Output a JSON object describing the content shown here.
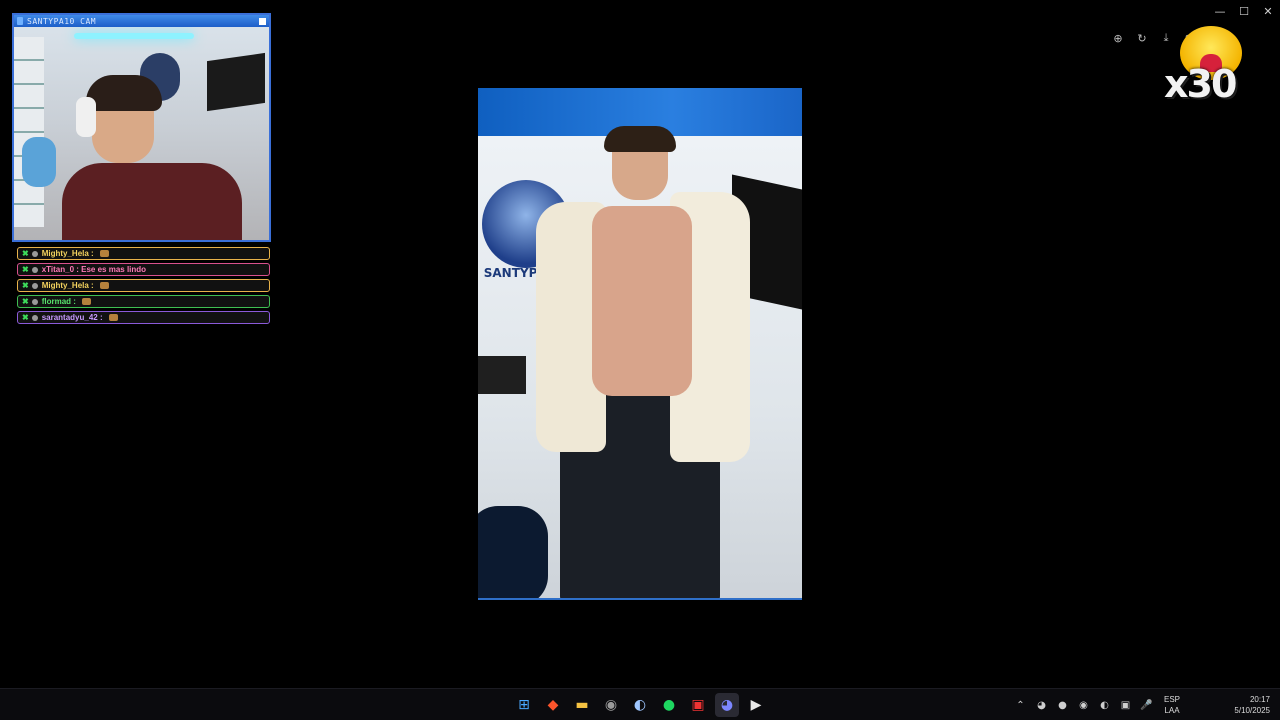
{
  "window_controls": {
    "minimize": "—",
    "maximize": "☐",
    "close": "✕"
  },
  "cam": {
    "title": "SANTYPA10 CAM"
  },
  "chat": {
    "messages": [
      {
        "user": "Mighty_Hela",
        "text": "",
        "color": "#f4d35e",
        "border": "#e8b24a"
      },
      {
        "user": "xTitan_0",
        "text": "Ese es mas lindo",
        "color": "#ff7ab8",
        "border": "#d9518e"
      },
      {
        "user": "Mighty_Hela",
        "text": "",
        "color": "#f4d35e",
        "border": "#e8b24a"
      },
      {
        "user": "flormad",
        "text": "",
        "color": "#57e36c",
        "border": "#3fbf52"
      },
      {
        "user": "sarantadyu_42",
        "text": "",
        "color": "#c89bff",
        "border": "#8b5ad9"
      }
    ]
  },
  "viewer": {
    "logo_text": "SANTYPA10"
  },
  "tools": {
    "zoom": "⊕",
    "rotate": "↻",
    "download": "⤓",
    "close": "✕"
  },
  "alert": {
    "multiplier": "x30"
  },
  "taskbar": {
    "apps": [
      {
        "icon": "windows-icon",
        "glyph": "⊞",
        "color": "#4aa8ff"
      },
      {
        "icon": "brave-icon",
        "glyph": "◆",
        "color": "#fb542b"
      },
      {
        "icon": "folder-icon",
        "glyph": "▬",
        "color": "#f5c242"
      },
      {
        "icon": "chrome-icon",
        "glyph": "◉",
        "color": "#9a9a9a"
      },
      {
        "icon": "steam-icon",
        "glyph": "◐",
        "color": "#9fc7ff"
      },
      {
        "icon": "spotify-icon",
        "glyph": "●",
        "color": "#1ed760"
      },
      {
        "icon": "obs-mixer-icon",
        "glyph": "▣",
        "color": "#e33"
      },
      {
        "icon": "discord-icon",
        "glyph": "◕",
        "color": "#7c86ff"
      },
      {
        "icon": "media-player-icon",
        "glyph": "▶",
        "color": "#e8e8e8"
      }
    ],
    "tray": [
      "⌃",
      "◕",
      "●",
      "◉",
      "◐",
      "▣",
      "🎤",
      "",
      "",
      ""
    ],
    "language": {
      "line1": "ESP",
      "line2": "LAA"
    },
    "clock": {
      "time": "20:17",
      "date": "5/10/2025"
    }
  }
}
